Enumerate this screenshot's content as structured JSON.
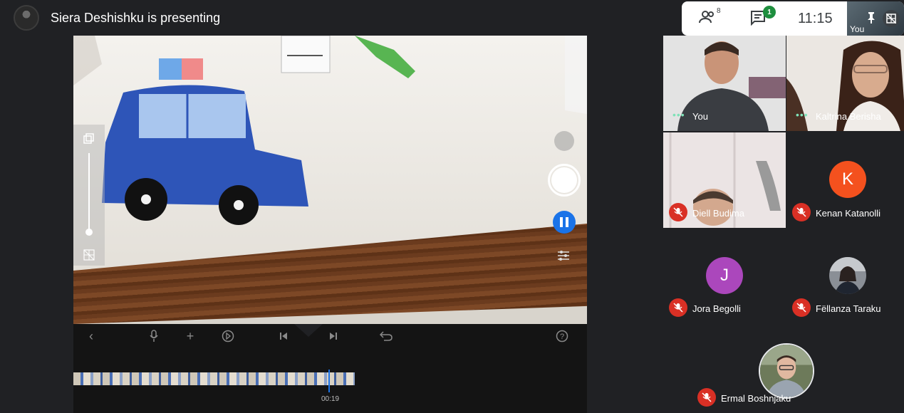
{
  "header": {
    "presenting_text": "Siera Deshishku is presenting"
  },
  "controls": {
    "participants_count": "8",
    "chat_badge": "1",
    "clock": "11:15",
    "self_label": "You"
  },
  "editor": {
    "timecode": "00:19"
  },
  "participants": [
    {
      "name": "You",
      "status": "speaking"
    },
    {
      "name": "Kaltrina Berisha",
      "status": "speaking"
    },
    {
      "name": "Diell Budima",
      "status": "muted"
    },
    {
      "name": "Kenan Katanolli",
      "status": "muted",
      "initial": "K",
      "avatar_color": "#f4511e"
    },
    {
      "name": "Jora Begolli",
      "status": "muted",
      "initial": "J",
      "avatar_color": "#ab47bc"
    },
    {
      "name": "Fëllanza Taraku",
      "status": "muted"
    },
    {
      "name": "Ermal Boshnjaku",
      "status": "muted"
    }
  ],
  "colors": {
    "accent": "#1a73e8",
    "muted_red": "#d93025",
    "badge_green": "#1e8e3e"
  }
}
